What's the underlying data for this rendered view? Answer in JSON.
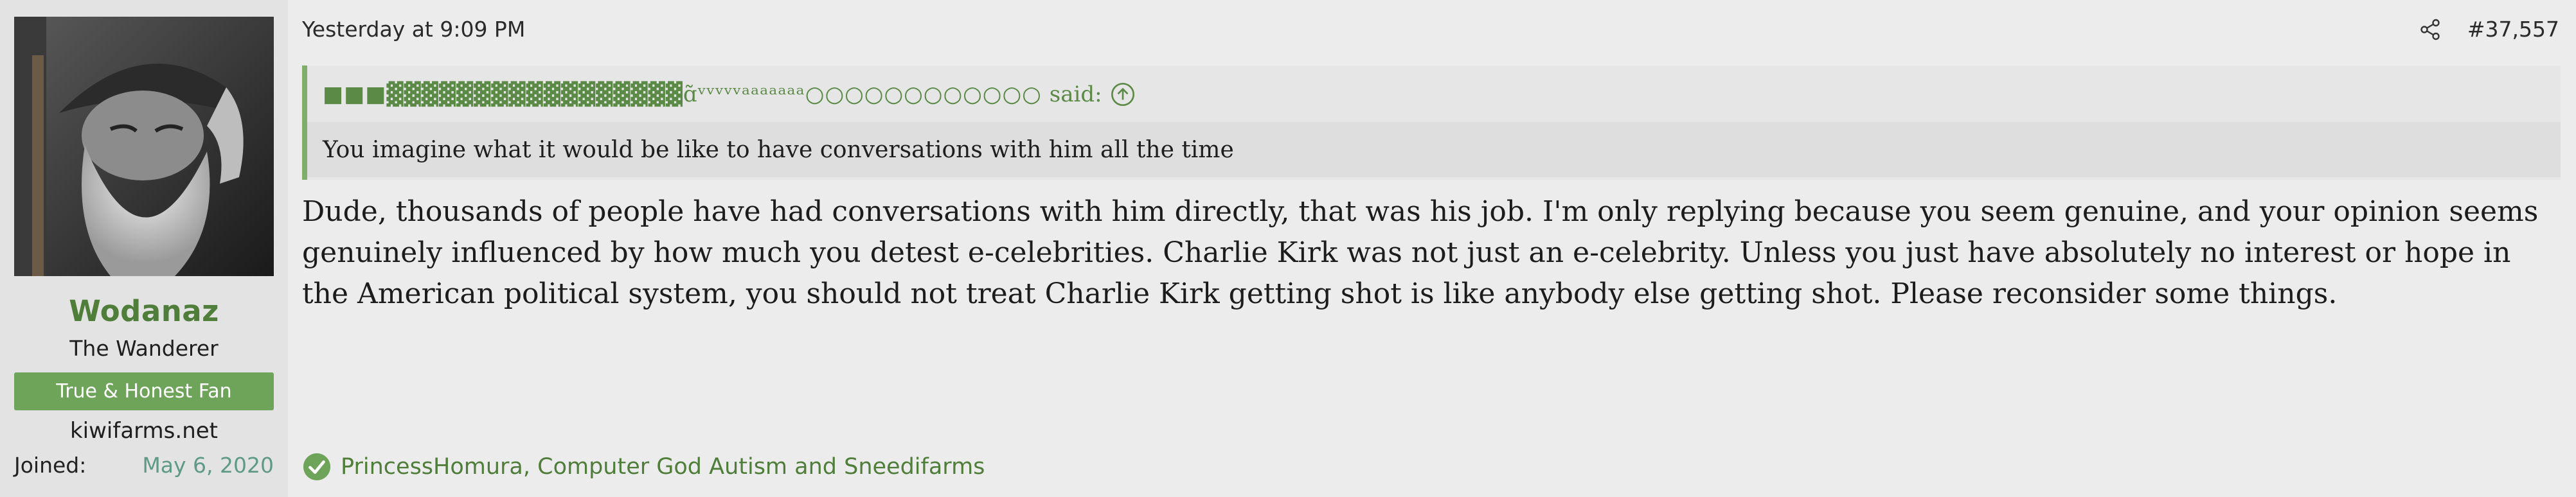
{
  "user": {
    "name": "Wodanaz",
    "title": "The Wanderer",
    "banner": "True & Honest Fan",
    "site": "kiwifarms.net",
    "joined_label": "Joined:",
    "joined_value": "May 6, 2020"
  },
  "post": {
    "timestamp": "Yesterday at 9:09 PM",
    "number": "#37,557",
    "icons": {
      "share": "share-icon",
      "quote_up": "arrow-up-circle-icon",
      "reaction": "check-circle-icon"
    },
    "quote": {
      "author": "■■■▓▓▓▓▓▓▓▓▓▓▓▓▓▓▓▓▓ɑ̃ᵛᵛᵛᵛᵛᵃᵃᵃᵃᵃᵃᵃ○○○○○○○○○○○○",
      "said": "said:",
      "text": "You imagine what it would be like to have conversations with him all the time"
    },
    "body": "Dude, thousands of people have had conversations with him directly, that was his job. I'm only replying because you seem genuine, and your opinion seems genuinely influenced by how much you detest e-celebrities. Charlie Kirk was not just an e-celebrity. Unless you just have absolutely no interest or hope in the American political system, you should not treat Charlie Kirk getting shot is like anybody else getting shot. Please reconsider some things.",
    "reactions": "PrincessHomura, Computer God Autism and Sneedifarms"
  },
  "colors": {
    "accent_green": "#4f7d3a",
    "banner_green": "#6ea35a",
    "quote_border": "#7fae6c",
    "joined_date": "#5e9a87"
  }
}
